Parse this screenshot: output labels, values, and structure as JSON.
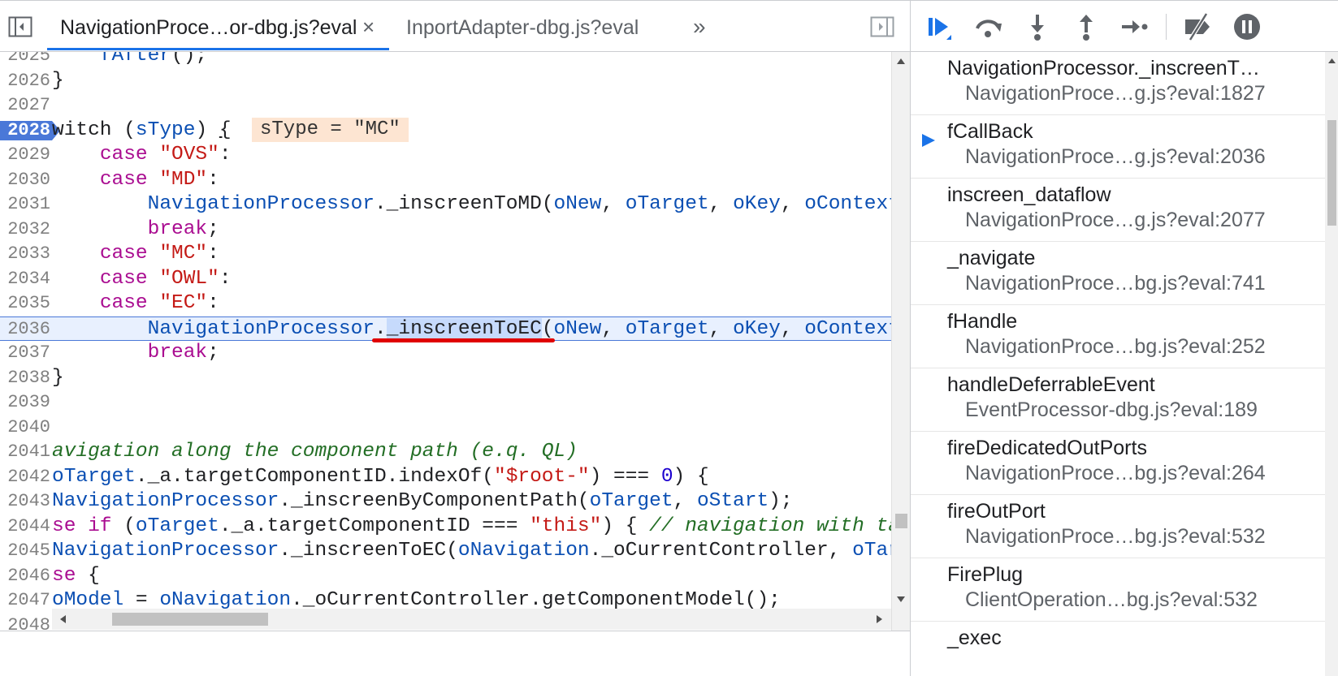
{
  "editor": {
    "tabs": [
      {
        "label": "NavigationProce…or-dbg.js?eval",
        "active": true
      },
      {
        "label": "InportAdapter-dbg.js?eval",
        "active": false
      }
    ],
    "close_glyph": "×",
    "more_glyph": "»",
    "inline_value": "sType = \"MC\"",
    "icons": [
      "toggle-navigator-icon",
      "close-icon",
      "more-tabs-icon",
      "toggle-debugger-icon"
    ]
  },
  "code": {
    "lines": [
      {
        "n": "2025",
        "html": "    <span class=\"var\">fAfter</span>();"
      },
      {
        "n": "2026",
        "html": "}"
      },
      {
        "n": "2027",
        "html": ""
      },
      {
        "n": "2028",
        "html": "witch (<span class=\"var\">sType</span>) <span class=\"ul\">{</span>",
        "breakpoint": true
      },
      {
        "n": "2029",
        "html": "    <span class=\"kw\">case</span> <span class=\"str\">\"OVS\"</span>:"
      },
      {
        "n": "2030",
        "html": "    <span class=\"kw\">case</span> <span class=\"str\">\"MD\"</span>:"
      },
      {
        "n": "2031",
        "html": "        <span class=\"var\">NavigationProcessor</span>._inscreenToMD(<span class=\"var\">oNew</span>, <span class=\"var\">oTarget</span>, <span class=\"var\">oKey</span>, <span class=\"var\">oContext</span>, <span class=\"var\">o</span>"
      },
      {
        "n": "2032",
        "html": "        <span class=\"kw\">break</span>;"
      },
      {
        "n": "2033",
        "html": "    <span class=\"kw\">case</span> <span class=\"str\">\"MC\"</span>:"
      },
      {
        "n": "2034",
        "html": "    <span class=\"kw\">case</span> <span class=\"str\">\"OWL\"</span>:"
      },
      {
        "n": "2035",
        "html": "    <span class=\"kw\">case</span> <span class=\"str\">\"EC\"</span>:"
      },
      {
        "n": "2036",
        "html": "        <span class=\"var\">NavigationProcessor</span>.<span class=\"hl\">_inscreenToEC</span>(<span class=\"var\">oNew</span>, <span class=\"var\">oTarget</span>, <span class=\"var\">oKey</span>, <span class=\"var\">oContext</span>, <span class=\"var\">o</span>",
        "current": true
      },
      {
        "n": "2037",
        "html": "        <span class=\"kw\">break</span>;"
      },
      {
        "n": "2038",
        "html": "}"
      },
      {
        "n": "2039",
        "html": ""
      },
      {
        "n": "2040",
        "html": ""
      },
      {
        "n": "2041",
        "html": "<span class=\"cmt\">avigation along the component path (e.q. QL)</span>"
      },
      {
        "n": "2042",
        "html": "<span class=\"var\">oTarget</span>._a.targetComponentID.indexOf(<span class=\"str\">\"$root-\"</span>) === <span class=\"num\">0</span>) {"
      },
      {
        "n": "2043",
        "html": "<span class=\"var\">NavigationProcessor</span>._inscreenByComponentPath(<span class=\"var\">oTarget</span>, <span class=\"var\">oStart</span>);"
      },
      {
        "n": "2044",
        "html": "<span class=\"kw\">se if</span> (<span class=\"var\">oTarget</span>._a.targetComponentID === <span class=\"str\">\"this\"</span>) { <span class=\"cmt\">// navigation with targe</span>"
      },
      {
        "n": "2045",
        "html": "<span class=\"var\">NavigationProcessor</span>._inscreenToEC(<span class=\"var\">oNavigation</span>._oCurrentController, <span class=\"var\">oTarget</span>"
      },
      {
        "n": "2046",
        "html": "<span class=\"kw\">se</span> {"
      },
      {
        "n": "2047",
        "html": "<span class=\"var\">oModel</span> = <span class=\"var\">oNavigation</span>._oCurrentController.getComponentModel();"
      },
      {
        "n": "2048",
        "html": ""
      }
    ]
  },
  "debugger": {
    "toolbar": [
      {
        "name": "resume-icon",
        "title": "Resume script execution"
      },
      {
        "name": "step-over-icon",
        "title": "Step over next function call"
      },
      {
        "name": "step-into-icon",
        "title": "Step into next function call"
      },
      {
        "name": "step-out-icon",
        "title": "Step out of current function"
      },
      {
        "name": "step-icon",
        "title": "Step"
      },
      {
        "name": "deactivate-breakpoints-icon",
        "title": "Deactivate breakpoints"
      },
      {
        "name": "pause-on-exceptions-icon",
        "title": "Pause on exceptions"
      }
    ],
    "call_stack": [
      {
        "fn": "NavigationProcessor._inscreenT…",
        "loc": "NavigationProce…g.js?eval:1827",
        "current": false
      },
      {
        "fn": "fCallBack",
        "loc": "NavigationProce…g.js?eval:2036",
        "current": true
      },
      {
        "fn": "inscreen_dataflow",
        "loc": "NavigationProce…g.js?eval:2077",
        "current": false
      },
      {
        "fn": "_navigate",
        "loc": "NavigationProce…bg.js?eval:741",
        "current": false
      },
      {
        "fn": "fHandle",
        "loc": "NavigationProce…bg.js?eval:252",
        "current": false
      },
      {
        "fn": "handleDeferrableEvent",
        "loc": "EventProcessor-dbg.js?eval:189",
        "current": false
      },
      {
        "fn": "fireDedicatedOutPorts",
        "loc": "NavigationProce…bg.js?eval:264",
        "current": false
      },
      {
        "fn": "fireOutPort",
        "loc": "NavigationProce…bg.js?eval:532",
        "current": false
      },
      {
        "fn": "FirePlug",
        "loc": "ClientOperation…bg.js?eval:532",
        "current": false
      },
      {
        "fn": "_exec",
        "loc": "",
        "current": false
      }
    ]
  },
  "colors": {
    "accent": "#1a73e8",
    "keyword": "#aa0d91",
    "string": "#c41a16",
    "comment": "#236e25",
    "identifier": "#0b4fb3",
    "current_line_bg": "#e8f0fe",
    "underline_red": "#e00000",
    "inline_value_bg": "#fde5d2"
  }
}
